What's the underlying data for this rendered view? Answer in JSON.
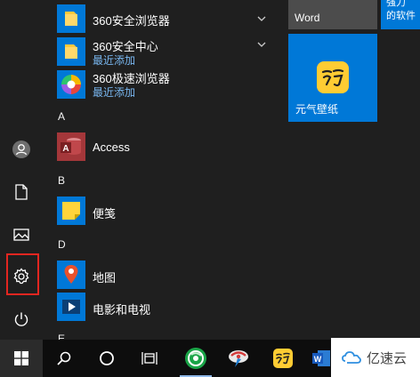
{
  "app_list": {
    "items": [
      {
        "name": "360安全浏览器",
        "subtitle": "",
        "icon": "folder-icon",
        "expandable": true
      },
      {
        "name": "360安全中心",
        "subtitle": "最近添加",
        "icon": "folder-icon",
        "expandable": true
      },
      {
        "name": "360极速浏览器",
        "subtitle": "最近添加",
        "icon": "360-speed-browser-icon",
        "expandable": false
      },
      {
        "name": "Access",
        "subtitle": "",
        "icon": "access-icon",
        "expandable": false
      },
      {
        "name": "便笺",
        "subtitle": "",
        "icon": "sticky-notes-icon",
        "expandable": false
      },
      {
        "name": "地图",
        "subtitle": "",
        "icon": "maps-icon",
        "expandable": false
      },
      {
        "name": "电影和电视",
        "subtitle": "",
        "icon": "movies-tv-icon",
        "expandable": false
      }
    ],
    "letters": [
      "A",
      "B",
      "D",
      "E"
    ]
  },
  "tiles": {
    "word_label": "Word",
    "strong_lines": [
      "强力",
      "的软件"
    ],
    "yuanqi_label": "元气壁纸"
  },
  "rail": {
    "items": [
      "user-icon",
      "documents-icon",
      "pictures-icon",
      "settings-icon",
      "power-icon"
    ],
    "highlighted": "settings-icon",
    "highlight_color": "#e32620"
  },
  "taskbar": {
    "items": [
      "windows-start-icon",
      "search-icon",
      "cortana-icon",
      "task-view-icon",
      "360-browser-icon",
      "security-tool-icon",
      "yuanqi-icon",
      "word-icon"
    ]
  },
  "watermark": {
    "text": "亿速云"
  },
  "colors": {
    "accent": "#0078d7",
    "background": "#1f1f1f",
    "link": "#79b7f0"
  }
}
